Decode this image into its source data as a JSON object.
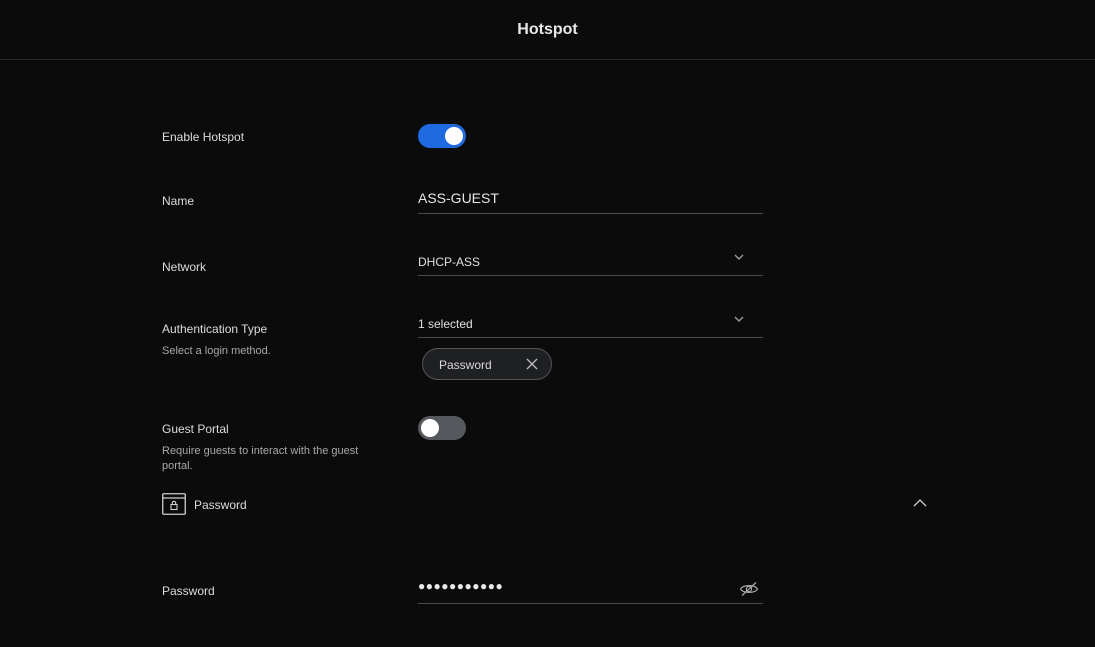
{
  "header": {
    "title": "Hotspot"
  },
  "enable_hotspot": {
    "label": "Enable Hotspot",
    "enabled": true
  },
  "name": {
    "label": "Name",
    "value": "ASS-GUEST"
  },
  "network": {
    "label": "Network",
    "value": "DHCP-ASS"
  },
  "auth_type": {
    "label": "Authentication Type",
    "description": "Select a login method.",
    "value": "1 selected",
    "chips": [
      {
        "label": "Password"
      }
    ]
  },
  "guest_portal": {
    "label": "Guest Portal",
    "description": "Require guests to interact with the guest portal.",
    "enabled": false
  },
  "password_section": {
    "title": "Password",
    "icon": "lock-window-icon"
  },
  "password": {
    "label": "Password",
    "value": "●●●●●●●●●●●"
  },
  "colors": {
    "accent": "#1f6ae0",
    "toggle_off": "#55585d",
    "background": "#0b0b0b"
  }
}
